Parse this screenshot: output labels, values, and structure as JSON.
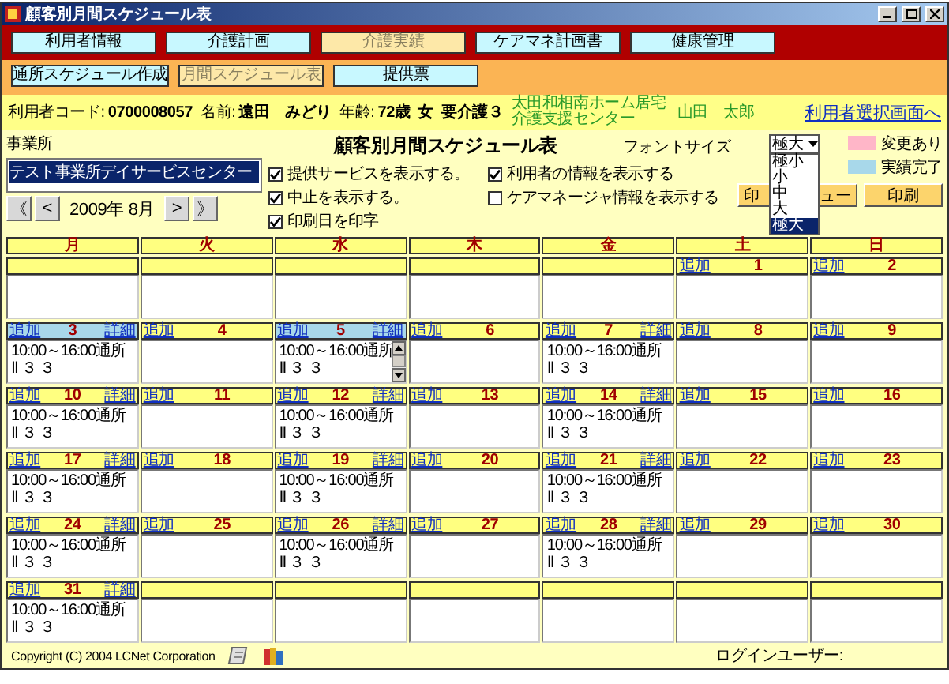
{
  "window": {
    "title": "顧客別月間スケジュール表"
  },
  "menu_tabs": [
    {
      "label": "利用者情報",
      "selected": false
    },
    {
      "label": "介護計画",
      "selected": false
    },
    {
      "label": "介護実績",
      "selected": true
    },
    {
      "label": "ケアマネ計画書",
      "selected": false
    },
    {
      "label": "健康管理",
      "selected": false
    }
  ],
  "sub_tabs": [
    {
      "label": "通所スケジュール作成",
      "selected": false
    },
    {
      "label": "月間スケジュール表",
      "selected": true
    },
    {
      "label": "提供票",
      "selected": false
    }
  ],
  "user_info": {
    "code_label": "利用者コード:",
    "code": "0700008057",
    "name_label": "名前:",
    "name": "遠田　みどり",
    "age_label": "年齢:",
    "age": "72歳",
    "sex": "女",
    "care_level": "要介護３",
    "care_office": "太田和相南ホーム居宅介護支援センター",
    "care_manager": "山田　太郎",
    "select_link": "利用者選択画面へ"
  },
  "schedule_title": "顧客別月間スケジュール表",
  "office": {
    "label": "事業所",
    "items": [
      {
        "label": "テスト事業所デイサービスセンター",
        "selected": true
      }
    ]
  },
  "month_nav": {
    "first": "《",
    "prev": "<",
    "current": "2009年 8月",
    "next": ">",
    "last": "》"
  },
  "options": [
    {
      "label": "提供サービスを表示する。",
      "checked": true
    },
    {
      "label": "利用者の情報を表示する",
      "checked": true
    },
    {
      "label": "中止を表示する。",
      "checked": true
    },
    {
      "label": "ケアマネージャ情報を表示する",
      "checked": false
    },
    {
      "label": "印刷日を印字",
      "checked": true
    }
  ],
  "font_size": {
    "label": "フォントサイズ",
    "value": "極大",
    "expanded": true,
    "options": [
      {
        "label": "極小",
        "selected": false
      },
      {
        "label": "小",
        "selected": false
      },
      {
        "label": "中",
        "selected": false
      },
      {
        "label": "大",
        "selected": false
      },
      {
        "label": "極大",
        "selected": true
      }
    ]
  },
  "preview_button": {
    "visible_start": "印",
    "visible_end": "ュー"
  },
  "print_button": "印刷",
  "legend": [
    {
      "label": "変更あり",
      "color": "#ffb6c8"
    },
    {
      "label": "実績完了",
      "color": "#a8d8ea"
    }
  ],
  "calendar": {
    "weekdays": [
      "月",
      "火",
      "水",
      "木",
      "金",
      "土",
      "日"
    ],
    "weeks": [
      [
        {
          "kind": "blank"
        },
        {
          "kind": "blank"
        },
        {
          "kind": "blank"
        },
        {
          "kind": "blank"
        },
        {
          "kind": "blank"
        },
        {
          "kind": "day",
          "day": "1",
          "add": "追加",
          "completed": false,
          "scrollable": false
        },
        {
          "kind": "day",
          "day": "2",
          "add": "追加",
          "completed": false,
          "scrollable": false
        }
      ],
      [
        {
          "kind": "day",
          "day": "3",
          "add": "追加",
          "detail": "詳細",
          "completed": true,
          "scrollable": false,
          "entries": [
            "10:00～16:00通所",
            "Ⅱ ３ ３"
          ]
        },
        {
          "kind": "day",
          "day": "4",
          "add": "追加",
          "completed": false,
          "scrollable": false
        },
        {
          "kind": "day",
          "day": "5",
          "add": "追加",
          "detail": "詳細",
          "completed": true,
          "scrollable": true,
          "entries": [
            "10:00～16:00通所",
            "Ⅱ ３ ３"
          ]
        },
        {
          "kind": "day",
          "day": "6",
          "add": "追加",
          "completed": false,
          "scrollable": false
        },
        {
          "kind": "day",
          "day": "7",
          "add": "追加",
          "detail": "詳細",
          "completed": false,
          "scrollable": false,
          "entries": [
            "10:00～16:00通所",
            "Ⅱ ３ ３"
          ]
        },
        {
          "kind": "day",
          "day": "8",
          "add": "追加",
          "completed": false,
          "scrollable": false
        },
        {
          "kind": "day",
          "day": "9",
          "add": "追加",
          "completed": false,
          "scrollable": false
        }
      ],
      [
        {
          "kind": "day",
          "day": "10",
          "add": "追加",
          "detail": "詳細",
          "completed": false,
          "scrollable": false,
          "entries": [
            "10:00～16:00通所",
            "Ⅱ ３ ３"
          ]
        },
        {
          "kind": "day",
          "day": "11",
          "add": "追加",
          "completed": false,
          "scrollable": false
        },
        {
          "kind": "day",
          "day": "12",
          "add": "追加",
          "detail": "詳細",
          "completed": false,
          "scrollable": false,
          "entries": [
            "10:00～16:00通所",
            "Ⅱ ３ ３"
          ]
        },
        {
          "kind": "day",
          "day": "13",
          "add": "追加",
          "completed": false,
          "scrollable": false
        },
        {
          "kind": "day",
          "day": "14",
          "add": "追加",
          "detail": "詳細",
          "completed": false,
          "scrollable": false,
          "entries": [
            "10:00～16:00通所",
            "Ⅱ ３ ３"
          ]
        },
        {
          "kind": "day",
          "day": "15",
          "add": "追加",
          "completed": false,
          "scrollable": false
        },
        {
          "kind": "day",
          "day": "16",
          "add": "追加",
          "completed": false,
          "scrollable": false
        }
      ],
      [
        {
          "kind": "day",
          "day": "17",
          "add": "追加",
          "detail": "詳細",
          "completed": false,
          "scrollable": false,
          "entries": [
            "10:00～16:00通所",
            "Ⅱ ３ ３"
          ]
        },
        {
          "kind": "day",
          "day": "18",
          "add": "追加",
          "completed": false,
          "scrollable": false
        },
        {
          "kind": "day",
          "day": "19",
          "add": "追加",
          "detail": "詳細",
          "completed": false,
          "scrollable": false,
          "entries": [
            "10:00～16:00通所",
            "Ⅱ ３ ３"
          ]
        },
        {
          "kind": "day",
          "day": "20",
          "add": "追加",
          "completed": false,
          "scrollable": false
        },
        {
          "kind": "day",
          "day": "21",
          "add": "追加",
          "detail": "詳細",
          "completed": false,
          "scrollable": false,
          "entries": [
            "10:00～16:00通所",
            "Ⅱ ３ ３"
          ]
        },
        {
          "kind": "day",
          "day": "22",
          "add": "追加",
          "completed": false,
          "scrollable": false
        },
        {
          "kind": "day",
          "day": "23",
          "add": "追加",
          "completed": false,
          "scrollable": false
        }
      ],
      [
        {
          "kind": "day",
          "day": "24",
          "add": "追加",
          "detail": "詳細",
          "completed": false,
          "scrollable": false,
          "entries": [
            "10:00～16:00通所",
            "Ⅱ ３ ３"
          ]
        },
        {
          "kind": "day",
          "day": "25",
          "add": "追加",
          "completed": false,
          "scrollable": false
        },
        {
          "kind": "day",
          "day": "26",
          "add": "追加",
          "detail": "詳細",
          "completed": false,
          "scrollable": false,
          "entries": [
            "10:00～16:00通所",
            "Ⅱ ３ ３"
          ]
        },
        {
          "kind": "day",
          "day": "27",
          "add": "追加",
          "completed": false,
          "scrollable": false
        },
        {
          "kind": "day",
          "day": "28",
          "add": "追加",
          "detail": "詳細",
          "completed": false,
          "scrollable": false,
          "entries": [
            "10:00～16:00通所",
            "Ⅱ ３ ３"
          ]
        },
        {
          "kind": "day",
          "day": "29",
          "add": "追加",
          "completed": false,
          "scrollable": false
        },
        {
          "kind": "day",
          "day": "30",
          "add": "追加",
          "completed": false,
          "scrollable": false
        }
      ],
      [
        {
          "kind": "day",
          "day": "31",
          "add": "追加",
          "detail": "詳細",
          "completed": false,
          "scrollable": false,
          "entries": [
            "10:00～16:00通所",
            "Ⅱ ３ ３"
          ]
        },
        {
          "kind": "blank"
        },
        {
          "kind": "blank"
        },
        {
          "kind": "blank"
        },
        {
          "kind": "blank"
        },
        {
          "kind": "blank"
        },
        {
          "kind": "blank"
        }
      ]
    ]
  },
  "footer": {
    "copyright": "Copyright (C) 2004 LCNet Corporation",
    "login_label": "ログインユーザー:"
  }
}
